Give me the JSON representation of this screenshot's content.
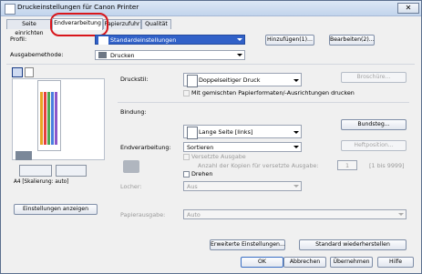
{
  "window": {
    "title": "Druckeinstellungen für Canon Printer",
    "close_glyph": "✕"
  },
  "tabs": [
    {
      "label": "Seite einrichten"
    },
    {
      "label": "Endverarbeitung"
    },
    {
      "label": "Papierzufuhr"
    },
    {
      "label": "Qualität"
    }
  ],
  "profile": {
    "label": "Profil:",
    "value": "Standardeinstellungen",
    "add_button": "Hinzufügen(1)...",
    "edit_button": "Bearbeiten(2)..."
  },
  "output": {
    "label": "Ausgabemethode:",
    "value": "Drucken"
  },
  "preview": {
    "caption": "A4 [Skalierung: auto]"
  },
  "duplex": {
    "label": "Druckstil:",
    "value": "Doppelseitiger Druck",
    "button": "Broschüre...",
    "mixed_label": "Mit gemischten Papierformaten/-Ausrichtungen drucken"
  },
  "binding": {
    "label": "Bindung:",
    "value": "Lange Seite [links]",
    "button": "Bundsteg..."
  },
  "finishing": {
    "label": "Endverarbeitung:",
    "value": "Sortieren",
    "button": "Heftposition...",
    "offset_label": "Versetzte Ausgabe",
    "offset_count_label": "Anzahl der Kopien für versetzte Ausgabe:",
    "offset_count_value": "1",
    "offset_range": "[1 bis 9999]",
    "rotate_label": "Drehen"
  },
  "hole": {
    "label": "Locher:",
    "value": "Aus"
  },
  "paper_output": {
    "label": "Papierausgabe:",
    "value": "Auto"
  },
  "settings_button": "Einstellungen anzeigen",
  "advanced_button": "Erweiterte Einstellungen...",
  "restore_button": "Standard wiederherstellen",
  "footer": {
    "ok": "OK",
    "cancel": "Abbrechen",
    "apply": "Übernehmen",
    "help": "Hilfe"
  },
  "icons": [
    "printer-icon",
    "document-icon",
    "duplex-icon",
    "binding-icon",
    "stapler-icon",
    "orientation-icons"
  ],
  "colors": {
    "accent": "#3161c8",
    "highlight_ring": "#d8161b"
  }
}
